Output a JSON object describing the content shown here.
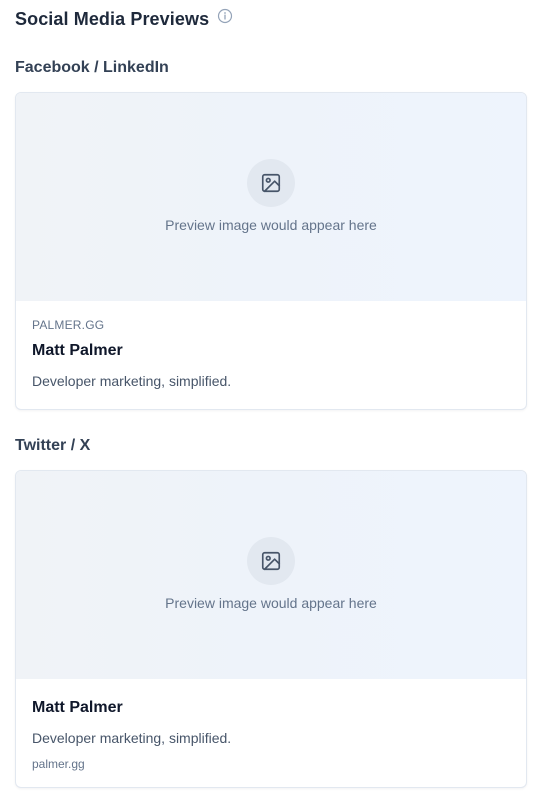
{
  "header": {
    "title": "Social Media Previews",
    "info_icon": "info-circle-icon"
  },
  "facebook": {
    "label": "Facebook / LinkedIn",
    "preview_text": "Preview image would appear here",
    "preview_icon": "image-icon",
    "domain": "PALMER.GG",
    "title": "Matt Palmer",
    "description": "Developer marketing, simplified."
  },
  "twitter": {
    "label": "Twitter / X",
    "preview_text": "Preview image would appear here",
    "preview_icon": "image-icon",
    "title": "Matt Palmer",
    "description": "Developer marketing, simplified.",
    "domain": "palmer.gg"
  },
  "colors": {
    "preview_bg": "#eef3fa",
    "icon_circle": "#e2e8f0",
    "border": "#e2e8f0",
    "title_text": "#0f172a",
    "muted_text": "#64748b"
  }
}
